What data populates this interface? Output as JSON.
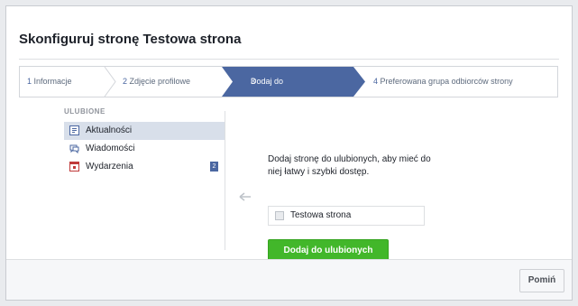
{
  "dialog": {
    "title": "Skonfiguruj stronę Testowa strona"
  },
  "steps": [
    {
      "number": "1",
      "label": "Informacje"
    },
    {
      "number": "2",
      "label": "Zdjęcie profilowe"
    },
    {
      "number": "3",
      "label": "Dodaj do ulubionych",
      "active": true
    },
    {
      "number": "4",
      "label": "Preferowana grupa odbiorców strony"
    }
  ],
  "sidebar": {
    "header": "ULUBIONE",
    "items": [
      {
        "label": "Aktualności",
        "icon": "news-feed-icon",
        "active": true
      },
      {
        "label": "Wiadomości",
        "icon": "messages-icon"
      },
      {
        "label": "Wydarzenia",
        "icon": "calendar-icon",
        "badge": "2"
      }
    ]
  },
  "main": {
    "description": "Dodaj stronę do ulubionych, aby mieć do niej łatwy i szybki dostęp.",
    "page_name": "Testowa strona",
    "add_button": "Dodaj do ulubionych"
  },
  "footer": {
    "skip_button": "Pomiń"
  },
  "colors": {
    "active_step": "#4b67a1",
    "primary_button": "#42b72a",
    "nav_active": "#d8dfea"
  }
}
